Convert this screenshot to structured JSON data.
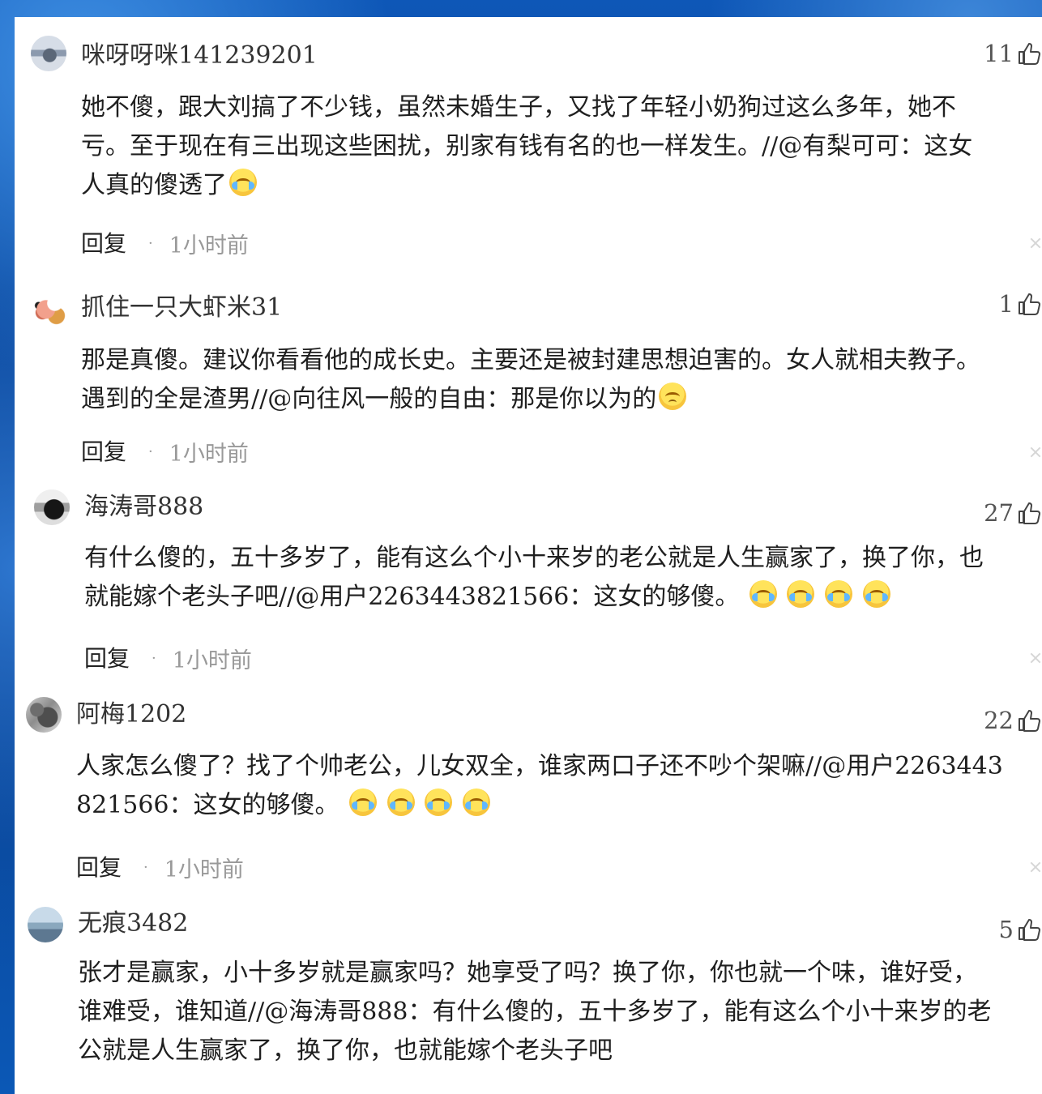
{
  "comments": [
    {
      "username": "咪呀呀咪141239201",
      "likes": "11",
      "lines": [
        "她不傻，跟大刘搞了不少钱，虽然未婚生子，又找了年轻小奶狗过这么多年，她不",
        "亏。至于现在有三出现这些困扰，别家有钱有名的也一样发生。//@有梨可可：这女",
        "人真的傻透了"
      ],
      "reply": "回复",
      "time": "1小时前"
    },
    {
      "username": "抓住一只大虾米31",
      "likes": "1",
      "lines": [
        "那是真傻。建议你看看他的成长史。主要还是被封建思想迫害的。女人就相夫教子。",
        "遇到的全是渣男//@向往风一般的自由：那是你以为的"
      ],
      "reply": "回复",
      "time": "1小时前"
    },
    {
      "username": "海涛哥888",
      "likes": "27",
      "lines": [
        "有什么傻的，五十多岁了，能有这么个小十来岁的老公就是人生赢家了，换了你，也",
        "就能嫁个老头子吧//@用户2263443821566：这女的够傻。"
      ],
      "reply": "回复",
      "time": "1小时前"
    },
    {
      "username": "阿梅1202",
      "likes": "22",
      "lines": [
        "人家怎么傻了？找了个帅老公，儿女双全，谁家两口子还不吵个架嘛//@用户2263443",
        "821566：这女的够傻。"
      ],
      "reply": "回复",
      "time": "1小时前"
    },
    {
      "username": "无痕3482",
      "likes": "5",
      "lines": [
        "张才是赢家，小十多岁就是赢家吗？她享受了吗？换了你，你也就一个味，谁好受，",
        "谁难受，谁知道//@海涛哥888：有什么傻的，五十多岁了，能有这么个小十来岁的老",
        "公就是人生赢家了，换了你，也就能嫁个老头子吧"
      ]
    }
  ],
  "icons": {
    "like": "thumb-up-icon",
    "dismiss": "close-icon",
    "laugh_cry": "laughing-crying-emoji",
    "sad": "sad-emoji",
    "crying": "crying-emoji"
  }
}
